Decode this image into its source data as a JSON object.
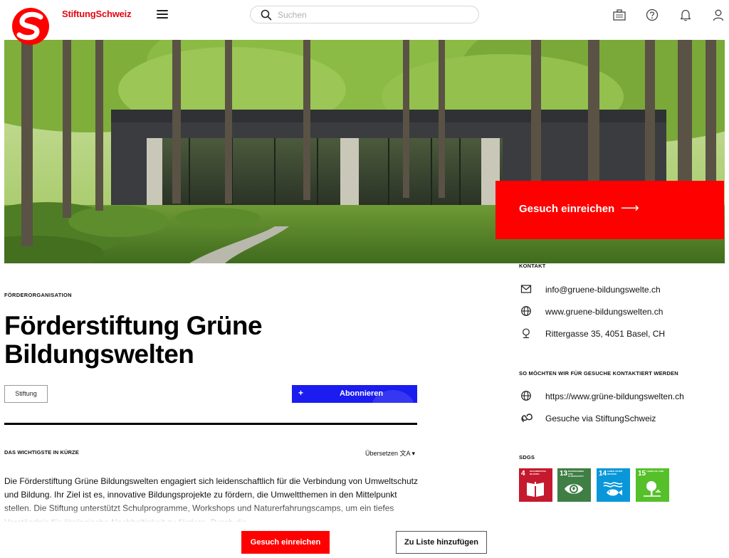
{
  "header": {
    "brand": "StiftungSchweiz",
    "search_placeholder": "Suchen",
    "icons": [
      "briefcase-icon",
      "help-icon",
      "bell-icon",
      "user-icon"
    ]
  },
  "hero": {
    "cta_label": "Gesuch einreichen",
    "cta_arrow": "⟶"
  },
  "organization": {
    "type_label": "FÖRDERORGANISATION",
    "name": "Förderstiftung Grüne Bildungswelten",
    "tag": "Stiftung",
    "subscribe_plus": "+",
    "subscribe_label": "Abonnieren"
  },
  "summary": {
    "label": "DAS WICHTIGSTE IN KÜRZE",
    "translate_label": "Übersetzen ⁠文A ▾",
    "text": "Die Förderstiftung Grüne Bildungswelten engagiert sich leidenschaftlich für die Verbindung von Umweltschutz und Bildung. Ihr Ziel ist es, innovative Bildungsprojekte zu fördern, die Umweltthemen in den Mittelpunkt stellen. Die Stiftung unterstützt Schulprogramme, Workshops und Naturerfahrungscamps, um ein tiefes Verständnis für ökologische Nachhaltigkeit zu fördern. Durch die"
  },
  "contact": {
    "label": "KONTAKT",
    "email": "info@gruene-bildungswelte.ch",
    "website": "www.gruene-bildungswelten.ch",
    "address": "Rittergasse 35, 4051 Basel, CH"
  },
  "applications": {
    "label": "SO MÖCHTEN WIR FÜR GESUCHE KONTAKTIERT WERDEN",
    "url": "https://www.grüne-bildungswelten.ch",
    "via": "Gesuche via StiftungSchweiz"
  },
  "sdgs": {
    "label": "SDGS",
    "items": [
      {
        "number": "4",
        "title": "HOCHWERTIGE BILDUNG",
        "color": "#c5192d",
        "icon": "book-icon"
      },
      {
        "number": "13",
        "title": "MASSNAHMEN ZUM KLIMASCHUTZ",
        "color": "#3f7e44",
        "icon": "eye-globe-icon"
      },
      {
        "number": "14",
        "title": "LEBEN UNTER WASSER",
        "color": "#0a97d9",
        "icon": "fish-icon"
      },
      {
        "number": "15",
        "title": "LEBEN AN LAND",
        "color": "#56c02b",
        "icon": "tree-icon"
      }
    ]
  },
  "bottom_bar": {
    "primary": "Gesuch einreichen",
    "secondary": "Zu Liste hinzufügen"
  },
  "colors": {
    "brand_red": "#ff0000",
    "subscribe_blue": "#1a1cf0"
  }
}
